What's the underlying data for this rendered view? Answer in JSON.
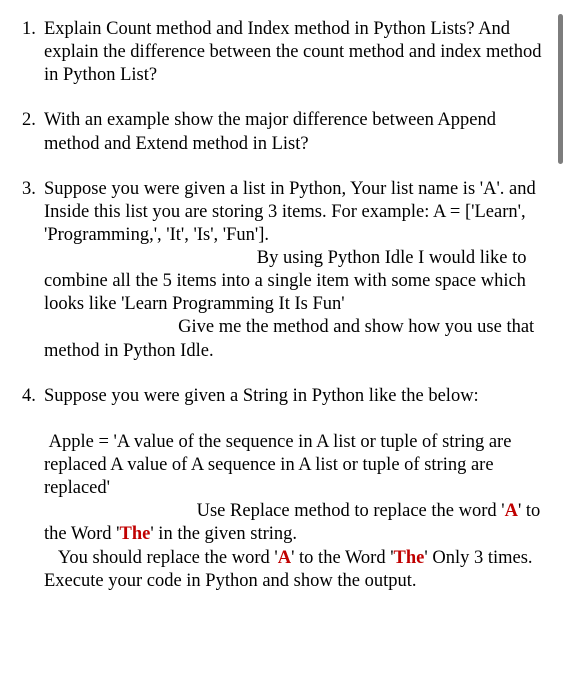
{
  "questions": {
    "q1": {
      "text": "Explain Count method and Index method in Python Lists? And explain the difference between the count method and index method in Python List?"
    },
    "q2": {
      "text": "With an example show the major difference between Append method and Extend method in List?"
    },
    "q3": {
      "p1": "Suppose you were given a list in Python, Your list name is 'A'. and Inside this list you are storing 3 items. For example: A = ['Learn', 'Programming,', 'It', 'Is', 'Fun'].",
      "p2a": "By using Python Idle I would like to combine all the 5 items into a single item with some space which looks like 'Learn Programming It Is Fun'",
      "p3a": "Give me the method and show how you use that method in Python Idle."
    },
    "q4": {
      "p1": "Suppose you were given a String in Python like the below:",
      "p2": " Apple = 'A value of the sequence in A list or tuple of string are replaced A value of A sequence in A list or tuple of string are replaced'",
      "p3_a": "Use Replace method to replace the word '",
      "p3_b": "A",
      "p3_c": "' to the Word '",
      "p3_d": "The",
      "p3_e": "' in the given string.",
      "p4_a": "   You should replace the word '",
      "p4_b": "A",
      "p4_c": "' to the Word '",
      "p4_d": "The",
      "p4_e": "' Only 3 times.",
      "p5": "Execute your code in Python and show the output."
    }
  }
}
